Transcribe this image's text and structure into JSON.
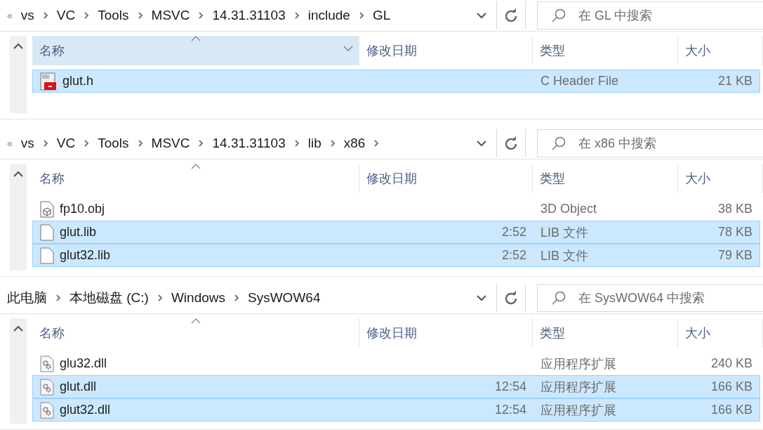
{
  "panels": [
    {
      "breadcrumb_lead": "«",
      "crumbs": [
        "vs",
        "VC",
        "Tools",
        "MSVC",
        "14.31.31103",
        "include",
        "GL"
      ],
      "trailing_chevron": false,
      "search": {
        "placeholder": "在 GL 中搜索"
      },
      "columns": [
        {
          "label": "名称",
          "sorted": true,
          "hovered": true
        },
        {
          "label": "修改日期",
          "sorted": false,
          "hovered": false
        },
        {
          "label": "类型",
          "sorted": false,
          "hovered": false
        },
        {
          "label": "大小",
          "sorted": false,
          "hovered": false
        }
      ],
      "rows": [
        {
          "kind": "header",
          "name": "glut.h",
          "date": "",
          "type": "C Header File",
          "size": "21 KB",
          "selected": true
        }
      ]
    },
    {
      "breadcrumb_lead": "«",
      "crumbs": [
        "vs",
        "VC",
        "Tools",
        "MSVC",
        "14.31.31103",
        "lib",
        "x86"
      ],
      "trailing_chevron": true,
      "search": {
        "placeholder": "在 x86 中搜索"
      },
      "columns": [
        {
          "label": "名称",
          "sorted": true,
          "hovered": false
        },
        {
          "label": "修改日期",
          "sorted": false,
          "hovered": false
        },
        {
          "label": "类型",
          "sorted": false,
          "hovered": false
        },
        {
          "label": "大小",
          "sorted": false,
          "hovered": false
        }
      ],
      "rows": [
        {
          "kind": "object",
          "name": "fp10.obj",
          "date": "",
          "type": "3D Object",
          "size": "38 KB",
          "selected": false
        },
        {
          "kind": "blank",
          "name": "glut.lib",
          "date": "2:52",
          "type": "LIB 文件",
          "size": "78 KB",
          "selected": true
        },
        {
          "kind": "blank",
          "name": "glut32.lib",
          "date": "2:52",
          "type": "LIB 文件",
          "size": "79 KB",
          "selected": true
        }
      ]
    },
    {
      "crumbs": [
        "此电脑",
        "本地磁盘 (C:)",
        "Windows",
        "SysWOW64"
      ],
      "trailing_chevron": false,
      "search": {
        "placeholder": "在 SysWOW64 中搜索"
      },
      "columns": [
        {
          "label": "名称",
          "sorted": true,
          "hovered": false
        },
        {
          "label": "修改日期",
          "sorted": false,
          "hovered": false
        },
        {
          "label": "类型",
          "sorted": false,
          "hovered": false
        },
        {
          "label": "大小",
          "sorted": false,
          "hovered": false
        }
      ],
      "rows": [
        {
          "kind": "dll",
          "name": "glu32.dll",
          "date": "",
          "type": "应用程序扩展",
          "size": "240 KB",
          "selected": false
        },
        {
          "kind": "dll",
          "name": "glut.dll",
          "date": "12:54",
          "type": "应用程序扩展",
          "size": "166 KB",
          "selected": true
        },
        {
          "kind": "dll",
          "name": "glut32.dll",
          "date": "12:54",
          "type": "应用程序扩展",
          "size": "166 KB",
          "selected": true
        }
      ]
    }
  ]
}
